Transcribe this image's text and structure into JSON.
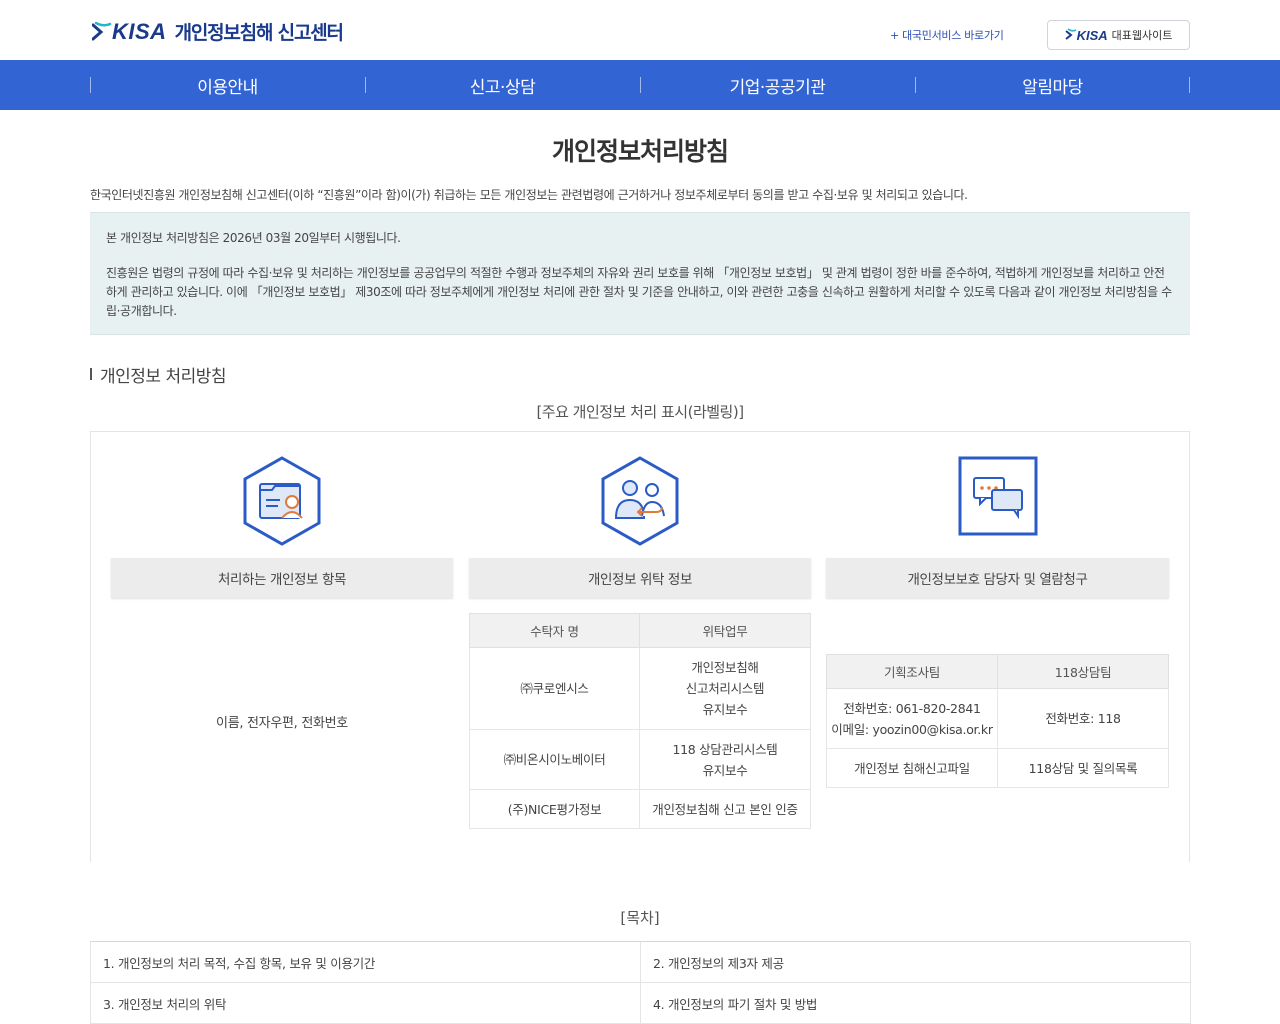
{
  "header": {
    "logo_kisa": "KISA",
    "logo_title": "개인정보침해 신고센터",
    "quick_link": "+ 대국민서비스 바로가기",
    "rep_site_kisa": "KISA",
    "rep_site_label": "대표웹사이트"
  },
  "nav": {
    "items": [
      {
        "label": "이용안내"
      },
      {
        "label": "신고·상담"
      },
      {
        "label": "기업·공공기관"
      },
      {
        "label": "알림마당"
      }
    ]
  },
  "main": {
    "title": "개인정보처리방침",
    "intro": "한국인터넷진흥원 개인정보침해 신고센터(이하 “진흥원”이라 함)이(가) 취급하는 모든 개인정보는 관련법령에 근거하거나 정보주체로부터 동의를 받고 수집·보유 및 처리되고 있습니다.",
    "notice_line1": "본 개인정보 처리방침은 2026년 03월 20일부터 시행됩니다.",
    "notice_line2": "진흥원은 법령의 규정에 따라 수집·보유 및 처리하는 개인정보를 공공업무의 적절한 수행과 정보주체의 자유와 권리 보호를 위해 「개인정보 보호법」 및 관계 법령이 정한 바를 준수하여, 적법하게 개인정보를 처리하고 안전하게 관리하고 있습니다. 이에 「개인정보 보호법」 제30조에 따라 정보주체에게 개인정보 처리에 관한 절차 및 기준을 안내하고, 이와 관련한 고충을 신속하고 원활하게 처리할 수 있도록 다음과 같이 개인정보 처리방침을 수립·공개합니다.",
    "section_title": "개인정보 처리방침",
    "label_title": "[주요 개인정보 처리 표시(라벨링)]"
  },
  "labels": {
    "col1": {
      "head": "처리하는 개인정보 항목",
      "text": "이름, 전자우편, 전화번호"
    },
    "col2": {
      "head": "개인정보 위탁 정보",
      "th1": "수탁자 명",
      "th2": "위탁업무",
      "rows": [
        {
          "name": "㈜쿠로엔시스",
          "work1": "개인정보침해",
          "work2": "신고처리시스템",
          "work3": "유지보수"
        },
        {
          "name": "㈜비온시이노베이터",
          "work1": "118 상담관리시스템",
          "work2": "유지보수"
        },
        {
          "name": "(주)NICE평가정보",
          "work1": "개인정보침해 신고 본인 인증"
        }
      ]
    },
    "col3": {
      "head": "개인정보보호 담당자 및 열람청구",
      "th1": "기획조사팀",
      "th2": "118상담팀",
      "phone1": "전화번호: 061-820-2841",
      "email1": "이메일: yoozin00@kisa.or.kr",
      "phone2": "전화번호: 118",
      "file1": "개인정보 침해신고파일",
      "file2": "118상담 및 질의목록"
    }
  },
  "toc": {
    "title": "[목차]",
    "items": [
      {
        "label": "1. 개인정보의 처리 목적, 수집 항목, 보유 및 이용기간"
      },
      {
        "label": "2. 개인정보의 제3자 제공"
      },
      {
        "label": "3. 개인정보 처리의 위탁"
      },
      {
        "label": "4. 개인정보의 파기 절차 및 방법"
      }
    ]
  },
  "colors": {
    "nav_bg": "#3364d4",
    "brand": "#1a3a8c",
    "notice_bg": "#e8f1f2"
  }
}
